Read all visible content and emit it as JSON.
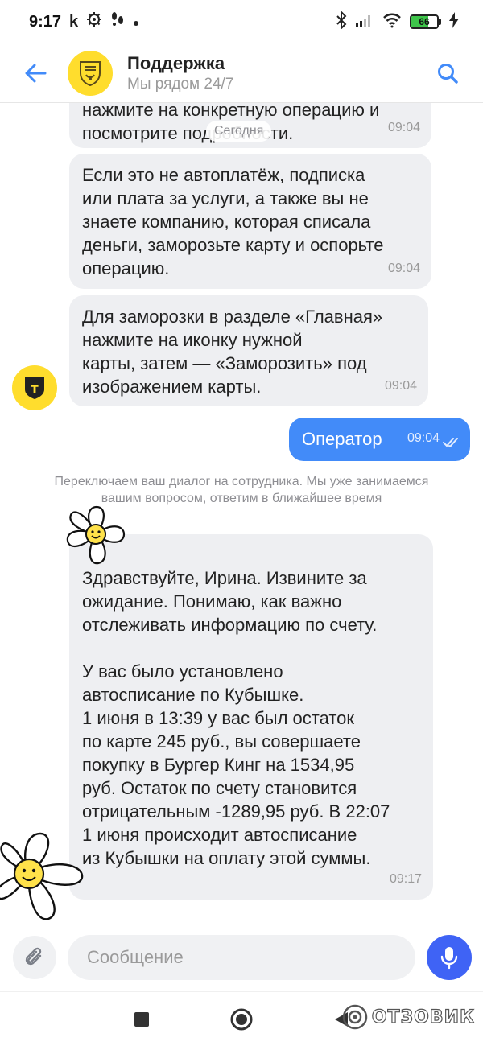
{
  "status_bar": {
    "time": "9:17",
    "carrier_glyph": "k",
    "battery_level": 66,
    "battery_label": "66",
    "icons": [
      "k-icon",
      "settings-icon",
      "steps-icon",
      "dot-icon",
      "bluetooth-icon",
      "signal-icon",
      "wifi-icon",
      "battery-icon",
      "charging-icon"
    ]
  },
  "header": {
    "title": "Поддержка",
    "subtitle": "Мы рядом 24/7"
  },
  "chat": {
    "date_label": "Сегодня",
    "messages": [
      {
        "direction": "in",
        "text": "нажмите на конкретную операцию и\nпосмотрите подробности.",
        "time": "09:04"
      },
      {
        "direction": "in",
        "text": "Если это не автоплатёж, подписка\nили плата за услуги, а также вы не\nзнаете компанию, которая списала\nденьги, заморозьте карту и оспорьте\nоперацию.",
        "time": "09:04"
      },
      {
        "direction": "in",
        "text": "Для заморозки в разделе «Главная»\nнажмите на иконку нужной\nкарты, затем — «Заморозить» под\nизображением карты.",
        "time": "09:04"
      },
      {
        "direction": "out",
        "text": "Оператор",
        "time": "09:04",
        "status": "read"
      },
      {
        "direction": "in",
        "text": "Здравствуйте, Ирина. Извините за\nожидание. Понимаю, как важно\nотслеживать информацию по счету.\n\nУ вас было установлено\nавтосписание по Кубышке.\n1 июня в 13:39 у вас был остаток\nпо карте 245 руб., вы совершаете\nпокупку в Бургер Кинг на 1534,95\nруб. Остаток по счету становится\nотрицательным -1289,95 руб. В 22:07\n1 июня происходит автосписание\nиз Кубышки на оплату этой суммы.",
        "time": "09:17"
      }
    ],
    "system_note": "Переключаем ваш диалог на сотрудника. Мы уже занимаемся вашим вопросом, ответим в ближайшее время",
    "bot_avatar_letter": "т"
  },
  "composer": {
    "placeholder": "Сообщение"
  },
  "watermark": {
    "text": "ОТЗОВИК"
  },
  "colors": {
    "accent_blue": "#428bf9",
    "mic_blue": "#3f63f5",
    "brand_yellow": "#ffdd2d",
    "incoming_bubble": "#eeeff2",
    "battery_green": "#3ec54a"
  }
}
